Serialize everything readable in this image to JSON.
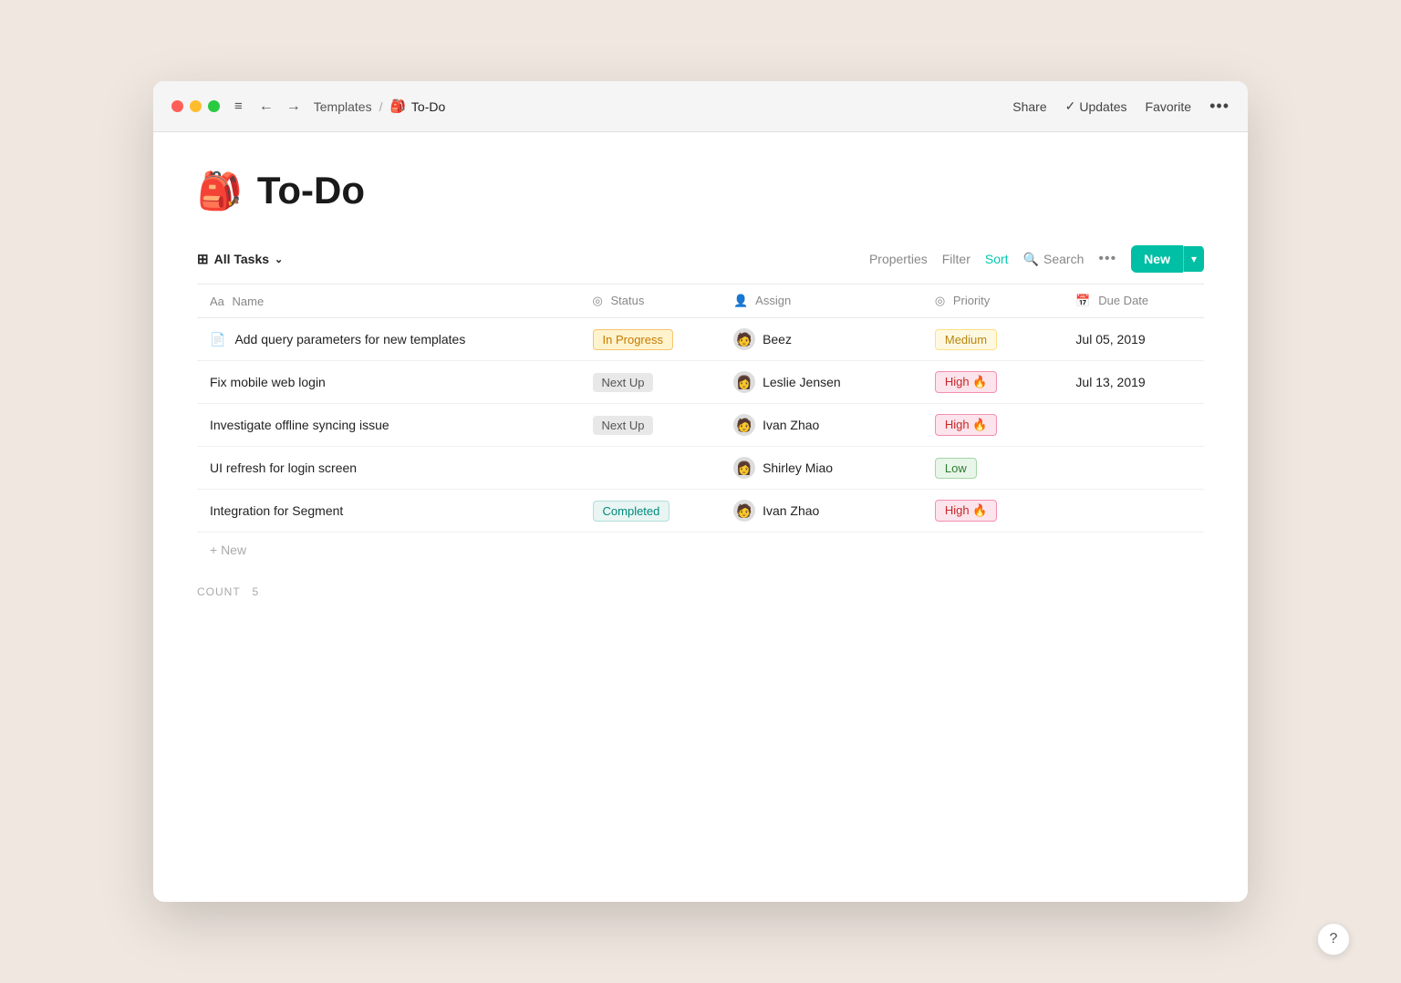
{
  "window": {
    "title": "To-Do"
  },
  "titlebar": {
    "menu_icon": "≡",
    "back_icon": "←",
    "forward_icon": "→",
    "breadcrumb_parent": "Templates",
    "breadcrumb_separator": "/",
    "page_icon": "🎒",
    "page_name": "To-Do",
    "actions": {
      "share": "Share",
      "updates_check": "✓",
      "updates": "Updates",
      "favorite": "Favorite",
      "more": "•••"
    }
  },
  "page": {
    "icon": "🎒",
    "title": "To-Do"
  },
  "toolbar": {
    "all_tasks_icon": "⊞",
    "all_tasks_label": "All Tasks",
    "all_tasks_chevron": "∨",
    "properties": "Properties",
    "filter": "Filter",
    "sort": "Sort",
    "search_icon": "🔍",
    "search": "Search",
    "dots": "•••",
    "new_label": "New",
    "new_chevron": "▾"
  },
  "table": {
    "columns": [
      {
        "id": "name",
        "icon": "Aa",
        "label": "Name"
      },
      {
        "id": "status",
        "icon": "◎",
        "label": "Status"
      },
      {
        "id": "assign",
        "icon": "👤",
        "label": "Assign"
      },
      {
        "id": "priority",
        "icon": "◎",
        "label": "Priority"
      },
      {
        "id": "duedate",
        "icon": "📅",
        "label": "Due Date"
      }
    ],
    "rows": [
      {
        "id": 1,
        "has_doc_icon": true,
        "name": "Add query parameters for new templates",
        "status": "In Progress",
        "status_type": "in-progress",
        "assignee": "Beez",
        "assignee_emoji": "🧑",
        "priority": "Medium",
        "priority_type": "medium",
        "priority_emoji": "",
        "due_date": "Jul 05, 2019"
      },
      {
        "id": 2,
        "has_doc_icon": false,
        "name": "Fix mobile web login",
        "status": "Next Up",
        "status_type": "next-up",
        "assignee": "Leslie Jensen",
        "assignee_emoji": "👩",
        "priority": "High 🔥",
        "priority_type": "high",
        "priority_emoji": "🔥",
        "due_date": "Jul 13, 2019"
      },
      {
        "id": 3,
        "has_doc_icon": false,
        "name": "Investigate offline syncing issue",
        "status": "Next Up",
        "status_type": "next-up",
        "assignee": "Ivan Zhao",
        "assignee_emoji": "🧑",
        "priority": "High 🔥",
        "priority_type": "high",
        "priority_emoji": "🔥",
        "due_date": ""
      },
      {
        "id": 4,
        "has_doc_icon": false,
        "name": "UI refresh for login screen",
        "status": "",
        "status_type": "none",
        "assignee": "Shirley Miao",
        "assignee_emoji": "👩",
        "priority": "Low",
        "priority_type": "low",
        "priority_emoji": "",
        "due_date": ""
      },
      {
        "id": 5,
        "has_doc_icon": false,
        "name": "Integration for Segment",
        "status": "Completed",
        "status_type": "completed",
        "assignee": "Ivan Zhao",
        "assignee_emoji": "🧑",
        "priority": "High 🔥",
        "priority_type": "high",
        "priority_emoji": "🔥",
        "due_date": ""
      }
    ],
    "add_new_label": "+ New",
    "count_label": "COUNT",
    "count_value": "5"
  },
  "help": {
    "label": "?"
  }
}
